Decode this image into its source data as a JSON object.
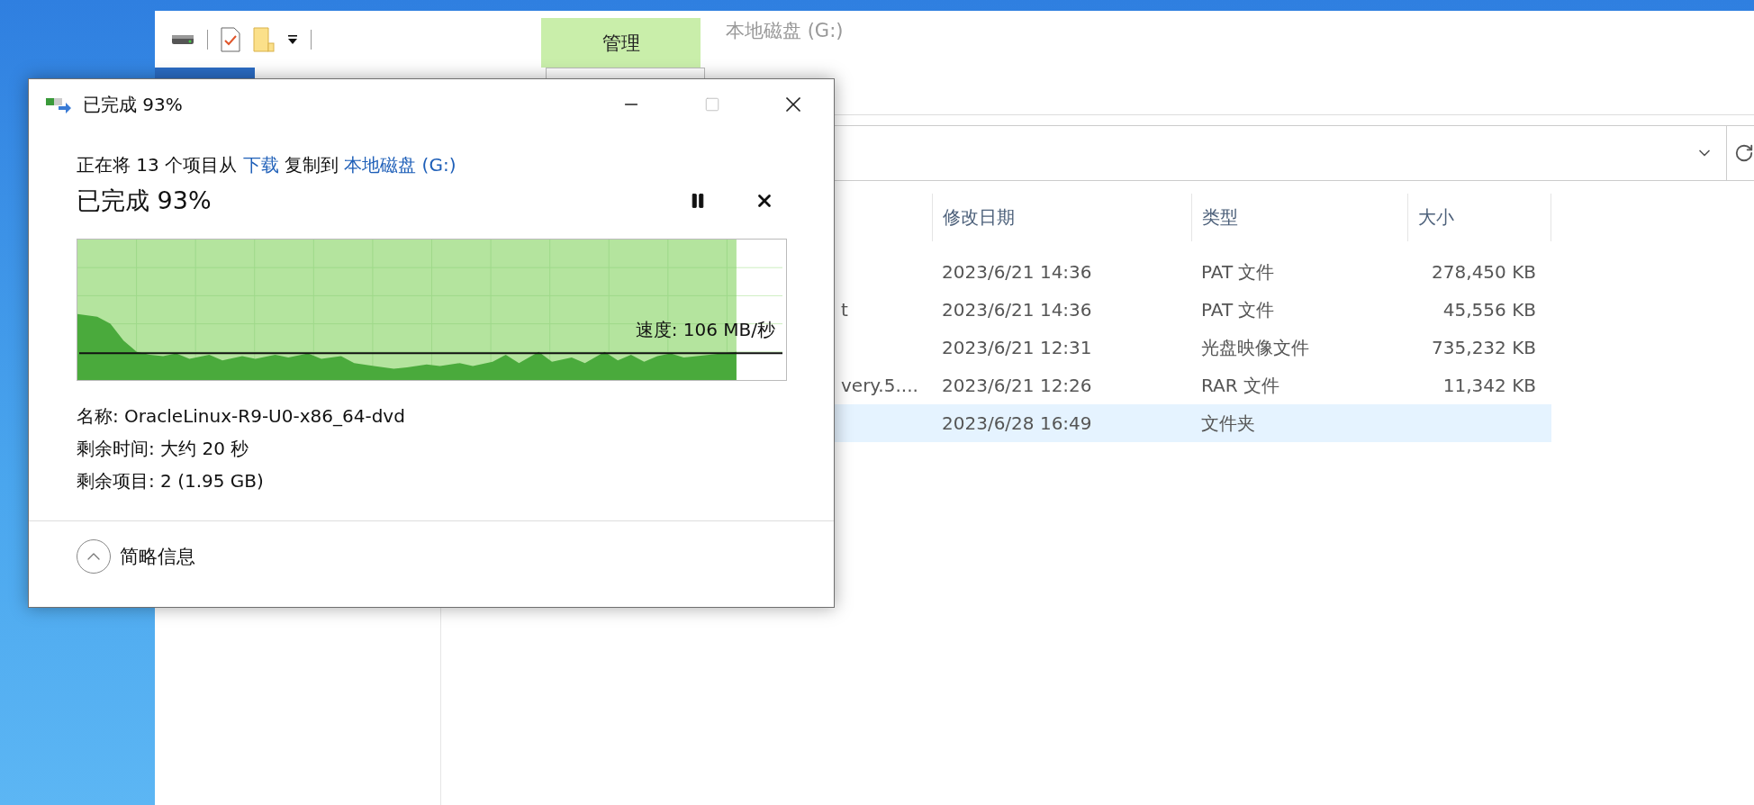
{
  "explorer": {
    "ribbon_tab": {
      "label": "管理",
      "selected": true
    },
    "title": "本地磁盘 (G:)",
    "columns": [
      "修改日期",
      "类型",
      "大小"
    ],
    "rows": [
      {
        "date": "2023/6/21 14:36",
        "type": "PAT 文件",
        "size": "278,450 KB",
        "selected": false
      },
      {
        "name": "t",
        "date": "2023/6/21 14:36",
        "type": "PAT 文件",
        "size": "45,556 KB",
        "selected": false
      },
      {
        "date": "2023/6/21 12:31",
        "type": "光盘映像文件",
        "size": "735,232 KB",
        "selected": false
      },
      {
        "name": "very.5....",
        "date": "2023/6/21 12:26",
        "type": "RAR 文件",
        "size": "11,342 KB",
        "selected": false
      },
      {
        "date": "2023/6/28 16:49",
        "type": "文件夹",
        "selected": true
      }
    ]
  },
  "dialog": {
    "title": "已完成 93%",
    "summary": [
      {
        "kind": "text",
        "text": "正在将 13 个项目从"
      },
      {
        "kind": "link",
        "text": "下载"
      },
      {
        "kind": "text",
        "text": "复制到"
      },
      {
        "kind": "link",
        "text": "本地磁盘 (G:)"
      }
    ],
    "progress": {
      "heading": "已完成 93%",
      "level": 0.93,
      "speed": "速度: 106 MB/秒"
    },
    "details": [
      "名称: OracleLinux-R9-U0-x86_64-dvd",
      "剩余时间: 大约 20 秒",
      "剩余项目: 2 (1.95 GB)"
    ],
    "toggle": "简略信息"
  }
}
